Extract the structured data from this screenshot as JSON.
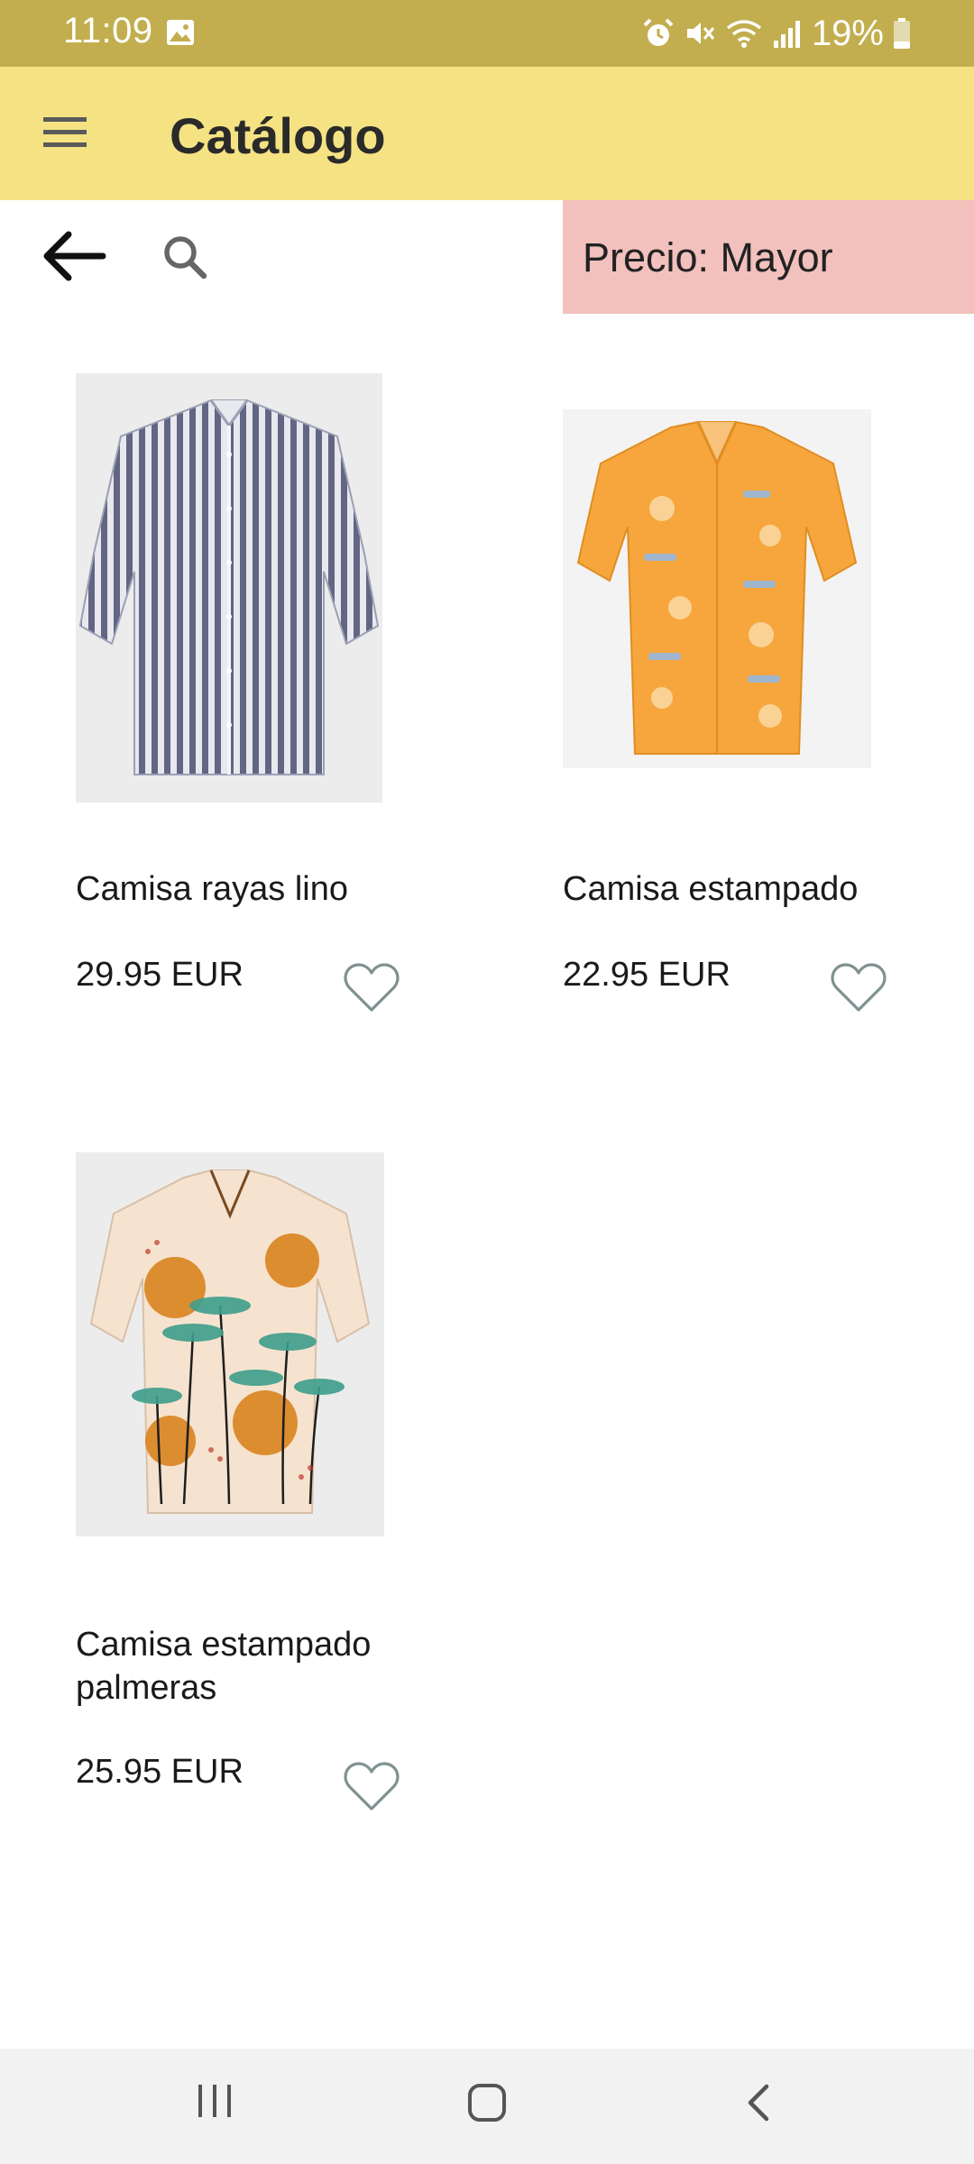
{
  "status_bar": {
    "time": "11:09",
    "battery": "19%",
    "icons": [
      "image-icon",
      "alarm-icon",
      "mute-icon",
      "wifi-icon",
      "signal-icon",
      "battery-icon"
    ]
  },
  "app_bar": {
    "title": "Catálogo",
    "background": "#f5e283"
  },
  "toolbar": {
    "sort_label": "Precio: Mayor",
    "sort_background": "#f2c1bd"
  },
  "products": [
    {
      "name": "Camisa rayas lino",
      "price": "29.95 EUR"
    },
    {
      "name": "Camisa estampado",
      "price": "22.95 EUR"
    },
    {
      "name": "Camisa estampado palmeras",
      "price": "25.95 EUR"
    }
  ],
  "nav_bar": {
    "icons": [
      "recent-apps-icon",
      "home-icon",
      "back-nav-icon"
    ]
  }
}
